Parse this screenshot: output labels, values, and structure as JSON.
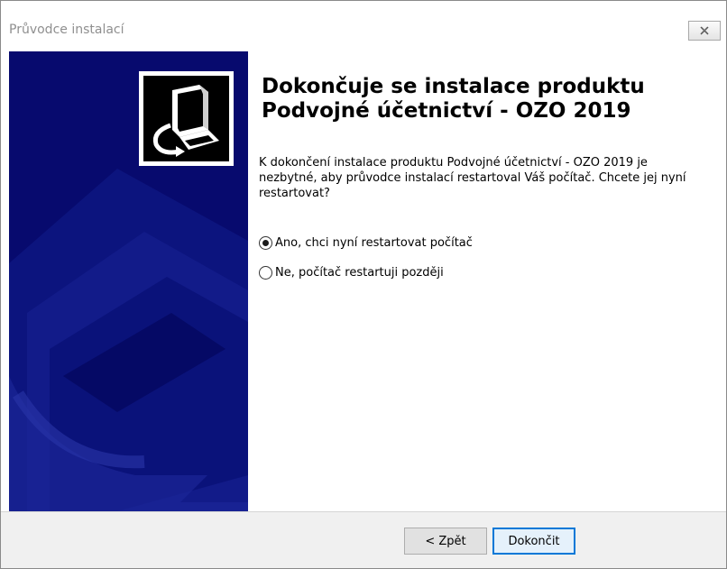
{
  "window": {
    "title": "Průvodce instalací",
    "close_icon": "close-x-icon"
  },
  "sidebar": {
    "logo_icon": "installer-computer-icon",
    "background_color": "#070a6e"
  },
  "main": {
    "heading_line1": "Dokončuje se instalace produktu",
    "heading_line2": "Podvojné účetnictví - OZO 2019",
    "description": "K dokončení instalace produktu Podvojné účetnictví - OZO 2019 je nezbytné, aby průvodce instalací restartoval Váš počítač. Chcete jej nyní restartovat?",
    "options": [
      {
        "label": "Ano, chci nyní restartovat počítač",
        "selected": true
      },
      {
        "label": "Ne, počítač restartuji později",
        "selected": false
      }
    ]
  },
  "footer": {
    "back_label": "< Zpět",
    "finish_label": "Dokončit",
    "accent_color": "#0078d7"
  }
}
